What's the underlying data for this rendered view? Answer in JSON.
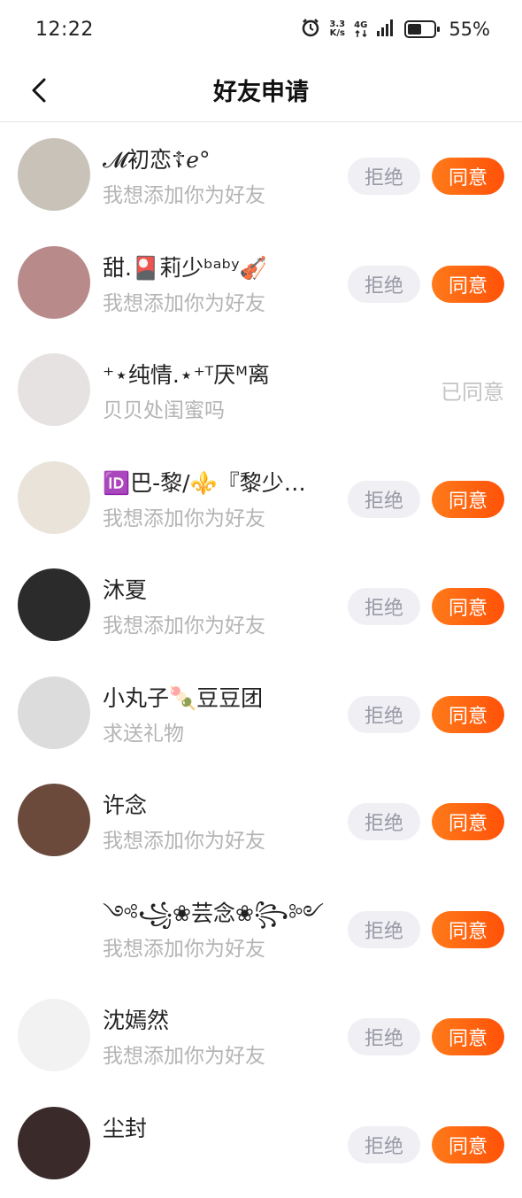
{
  "status_bar": {
    "time": "12:22",
    "speed_value": "3.3",
    "speed_unit": "K/s",
    "network": "4G",
    "battery_percent": "55%",
    "battery_level": 0.55,
    "icons": [
      "alarm-icon",
      "signal-icon",
      "battery-icon"
    ]
  },
  "nav": {
    "title": "好友申请",
    "back_icon": "chevron-left-icon"
  },
  "buttons": {
    "reject_label": "拒绝",
    "agree_label": "同意",
    "agreed_label": "已同意"
  },
  "requests": [
    {
      "name": "𝓜初恋☦︎ℯ°",
      "message": "我想添加你为好友",
      "state": "pending",
      "avatar_color": "#c9c2b8"
    },
    {
      "name": "甜.🎴莉少ᵇᵃᵇʸ🎻",
      "message": "我想添加你为好友",
      "state": "pending",
      "avatar_color": "#b98a8a"
    },
    {
      "name": "⁺⋆纯情.⋆⁺ᵀ厌ᴹ离",
      "message": "贝贝处闺蜜吗",
      "state": "agreed",
      "avatar_color": "#e7e2e2"
    },
    {
      "name": "🆔巴-黎/⚜️『黎少…",
      "message": "我想添加你为好友",
      "state": "pending",
      "avatar_color": "#e9e3da"
    },
    {
      "name": "沐夏",
      "message": "我想添加你为好友",
      "state": "pending",
      "avatar_color": "#2b2b2b"
    },
    {
      "name": "小丸子🍡豆豆团",
      "message": "求送礼物",
      "state": "pending",
      "avatar_color": "#dcdcdc"
    },
    {
      "name": "许念",
      "message": "我想添加你为好友",
      "state": "pending",
      "avatar_color": "#6b4a3c"
    },
    {
      "name": "༺꧁❀芸念❀꧂༻",
      "message": "我想添加你为好友",
      "state": "pending",
      "avatar_color": "#ffffff"
    },
    {
      "name": "沈嫣然",
      "message": "我想添加你为好友",
      "state": "pending",
      "avatar_color": "#f2f2f2"
    },
    {
      "name": "尘封",
      "message": "",
      "state": "pending",
      "avatar_color": "#3a2a2a"
    }
  ]
}
